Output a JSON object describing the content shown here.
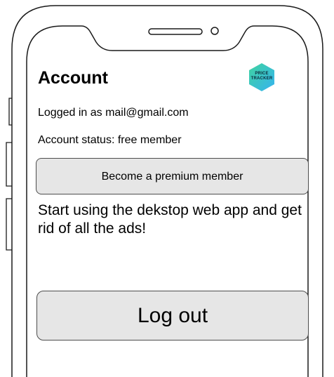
{
  "account": {
    "title": "Account",
    "logged_in_text": "Logged in as mail@gmail.com",
    "status_text": "Account status: free member",
    "premium_button_label": "Become a premium member",
    "promo_text": "Start using the dekstop web app and get rid of all the ads!",
    "logout_button_label": "Log out"
  },
  "logo": {
    "line1": "PRICE",
    "line2": "TRACKER",
    "colors": [
      "#3fd3a0",
      "#36b3f0"
    ]
  },
  "colors": {
    "button_fill": "#e6e6e6",
    "button_border": "#4d4d4d",
    "frame_stroke": "#1a1a1a"
  }
}
